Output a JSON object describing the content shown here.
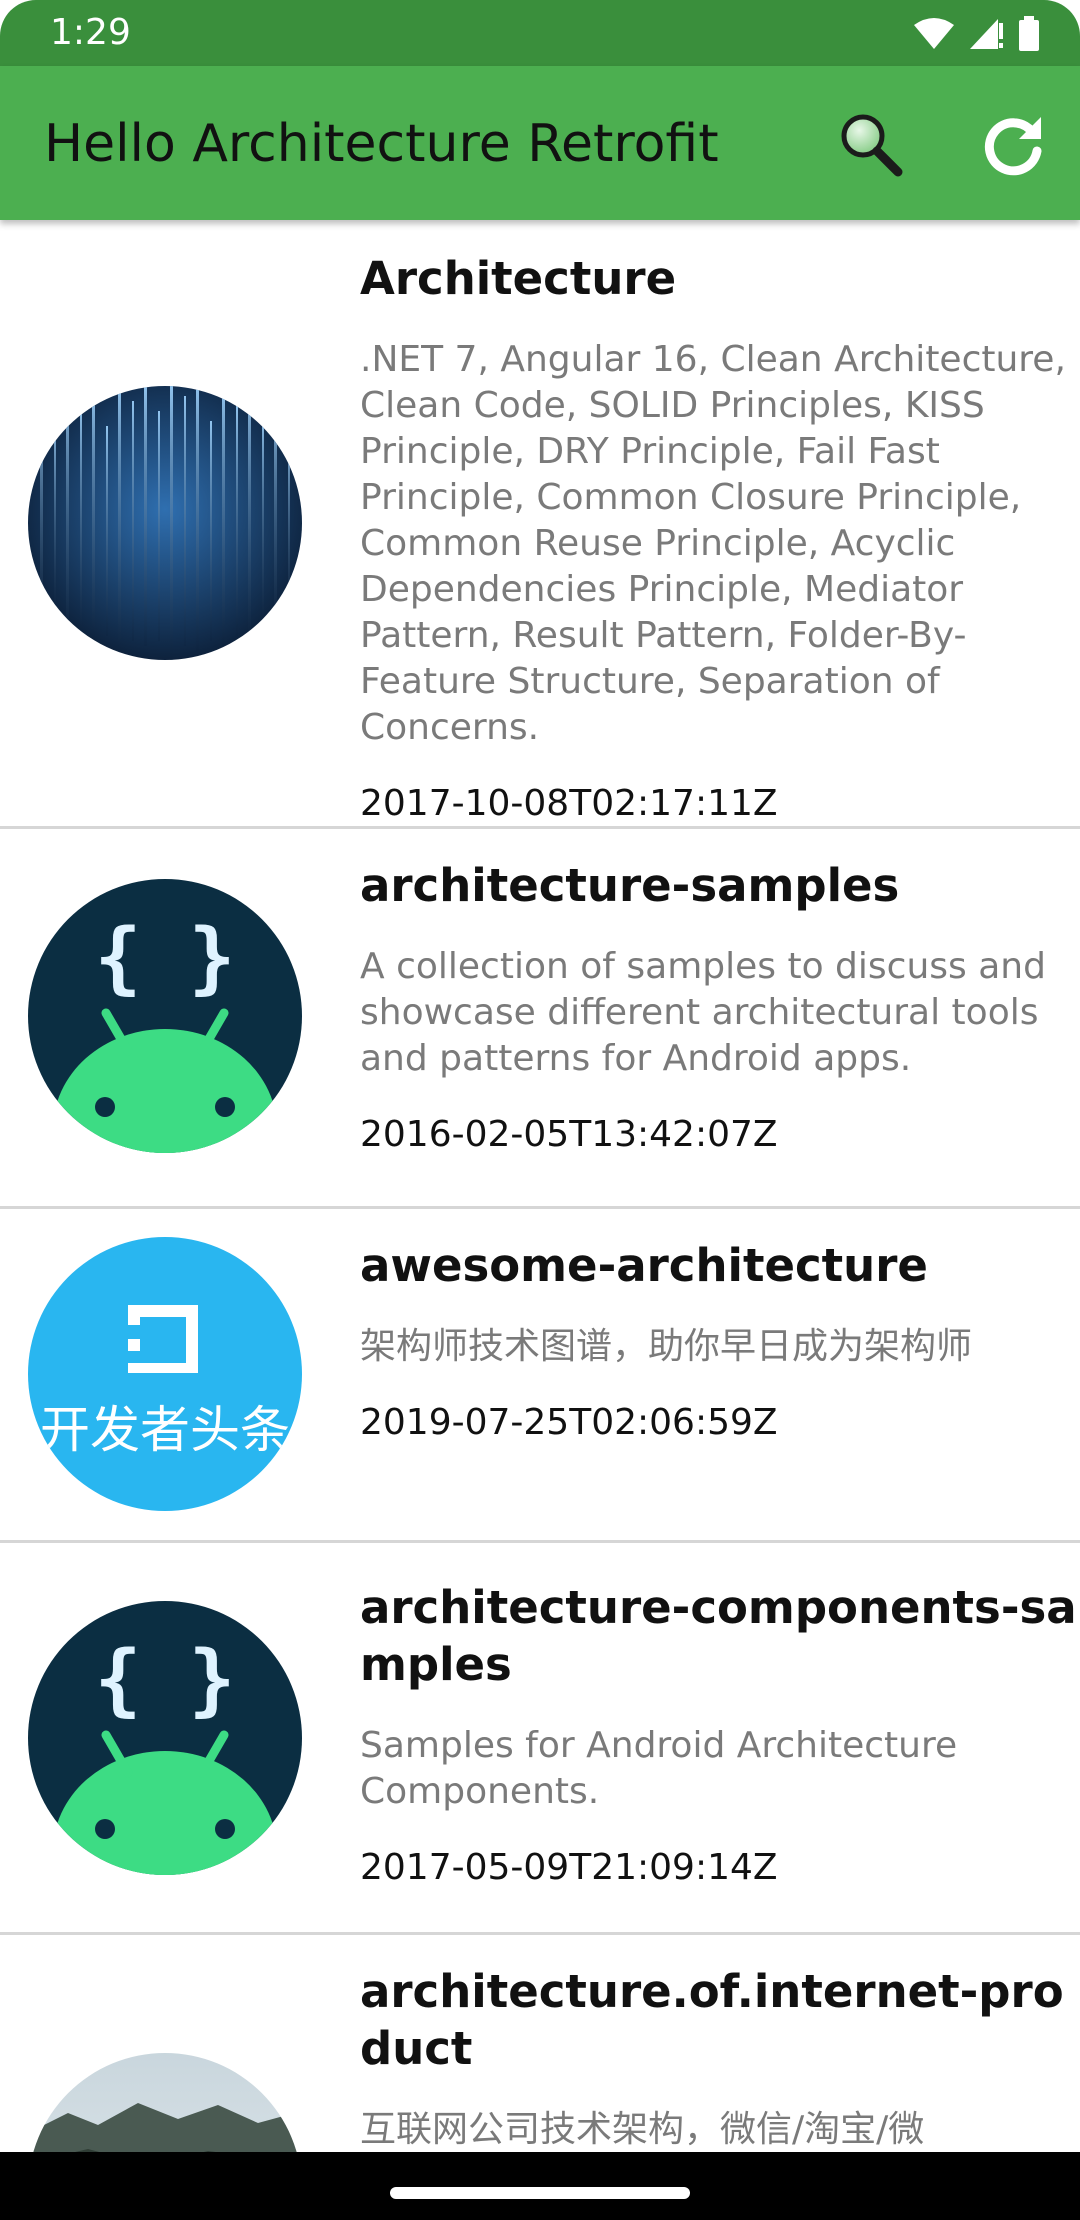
{
  "status_bar": {
    "time": "1:29"
  },
  "app_bar": {
    "title": "Hello Architecture Retrofit"
  },
  "repos": [
    {
      "name": "Architecture",
      "description": ".NET 7, Angular 16, Clean Architecture, Clean Code, SOLID Principles, KISS Principle, DRY Principle, Fail Fast Principle, Common Closure Principle, Common Reuse Principle, Acyclic Dependencies Principle, Mediator Pattern, Result Pattern, Folder-By-Feature Structure, Separation of Concerns.",
      "date": "2017-10-08T02:17:11Z",
      "avatar": "matrix-code-avatar"
    },
    {
      "name": "architecture-samples",
      "description": "A collection of samples to discuss and showcase different architectural tools and patterns for Android apps.",
      "date": "2016-02-05T13:42:07Z",
      "avatar": "android-braces-avatar"
    },
    {
      "name": "awesome-architecture",
      "description": "架构师技术图谱，助你早日成为架构师",
      "date": "2019-07-25T02:06:59Z",
      "avatar": "toutiao-avatar",
      "avatar_text": "开发者头条"
    },
    {
      "name": "architecture-components-samples",
      "description": "Samples for Android Architecture Components.",
      "date": "2017-05-09T21:09:14Z",
      "avatar": "android-braces-avatar"
    },
    {
      "name": "architecture.of.internet-product",
      "description": "互联网公司技术架构，微信/淘宝/微",
      "date": "",
      "avatar": "mountain-avatar"
    }
  ],
  "colors": {
    "app_bar": "#4caf50",
    "status_bar": "#3a8f3c",
    "android_dark": "#0b2e42",
    "android_green": "#3ddc84",
    "toutiao_blue": "#29b6f0"
  }
}
